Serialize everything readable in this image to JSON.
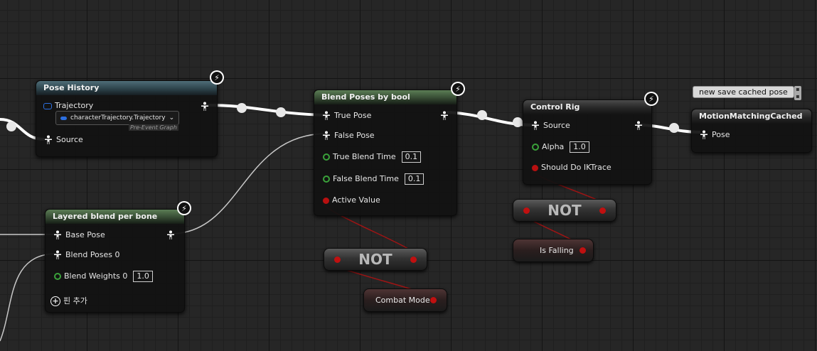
{
  "pose_history": {
    "title": "Pose History",
    "trajectory_label": "Trajectory",
    "trajectory_value": "characterTrajectory.Trajectory",
    "pre_event_label": "Pre-Event Graph",
    "source_label": "Source"
  },
  "layered_blend": {
    "title": "Layered blend per bone",
    "base_pose": "Base Pose",
    "blend_poses_0": "Blend Poses 0",
    "blend_weights_0": "Blend Weights 0",
    "blend_weights_value": "1.0",
    "add_pin": "핀 추가"
  },
  "blend_by_bool": {
    "title": "Blend Poses by bool",
    "true_pose": "True Pose",
    "false_pose": "False Pose",
    "true_blend_time": "True Blend Time",
    "true_blend_value": "0.1",
    "false_blend_time": "False Blend Time",
    "false_blend_value": "0.1",
    "active_value": "Active Value"
  },
  "control_rig": {
    "title": "Control Rig",
    "source": "Source",
    "alpha": "Alpha",
    "alpha_value": "1.0",
    "should_do_iktrace": "Should Do IKTrace"
  },
  "motion_matching": {
    "comment": "new save cached pose",
    "title": "MotionMatchingCached",
    "pose": "Pose"
  },
  "not_nodes": [
    "NOT",
    "NOT"
  ],
  "variables": {
    "combat_mode": "Combat Mode",
    "is_falling": "Is Falling"
  },
  "colors": {
    "pose_wire": "#ffffff",
    "bool_wire": "#a01414",
    "float_pin": "#3aa23a",
    "bool_pin": "#b81010",
    "struct_pin": "#2c6fe0"
  }
}
